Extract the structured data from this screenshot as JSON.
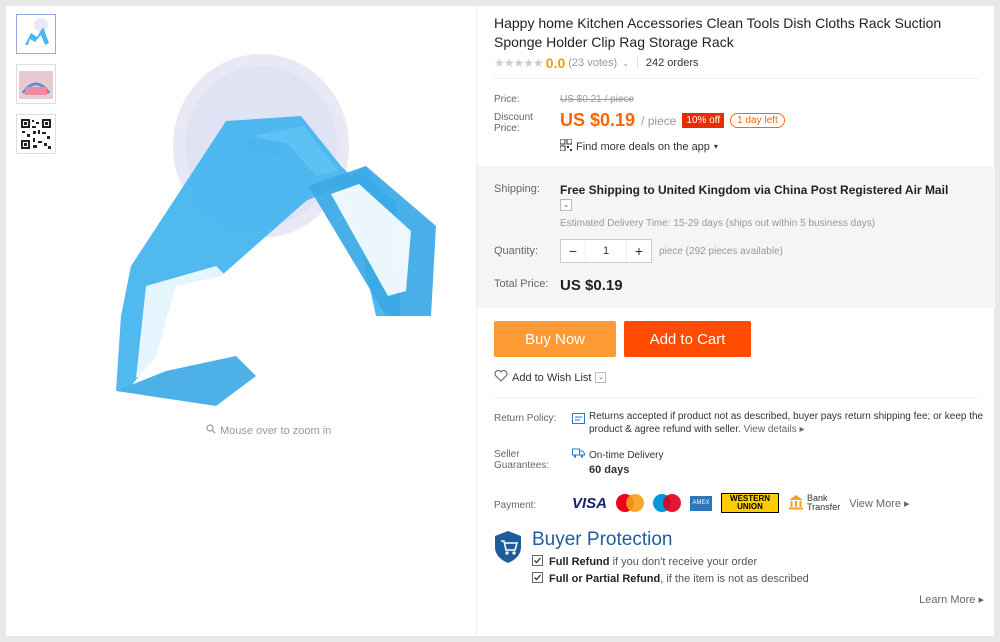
{
  "gallery": {
    "thumbnails": [
      "product-photo",
      "product-in-use-photo",
      "qr-code"
    ],
    "zoom_hint": "Mouse over to zoom in"
  },
  "product": {
    "title": "Happy home Kitchen Accessories Clean Tools Dish Cloths Rack Suction Sponge Holder Clip Rag Storage Rack",
    "rating_value": "0.0",
    "votes": "(23 votes)",
    "orders": "242 orders"
  },
  "pricing": {
    "price_label": "Price:",
    "old_price": "US $0.21 / piece",
    "discount_label": "Discount Price:",
    "discount_price": "US $0.19",
    "unit": "/ piece",
    "discount_badge": "10% off",
    "time_badge": "1 day left",
    "app_deals": "Find more deals on the app"
  },
  "shipping": {
    "label": "Shipping:",
    "free_text": "Free Shipping to",
    "destination": "United Kingdom via China Post Registered Air Mail",
    "estimate": "Estimated Delivery Time: 15-29 days (ships out within 5 business days)"
  },
  "quantity": {
    "label": "Quantity:",
    "value": "1",
    "minus": "−",
    "plus": "+",
    "available": "piece (292 pieces available)"
  },
  "total": {
    "label": "Total Price:",
    "value": "US $0.19"
  },
  "actions": {
    "buy_now": "Buy Now",
    "add_to_cart": "Add to Cart",
    "wish_list": "Add to Wish List"
  },
  "policy": {
    "return_label": "Return Policy:",
    "return_text": "Returns accepted if product not as described, buyer pays return shipping fee; or keep the product & agree refund with seller.",
    "view_details": "View details ▸",
    "guarantee_label_1": "Seller",
    "guarantee_label_2": "Guarantees:",
    "on_time": "On-time Delivery",
    "days": "60 days",
    "payment_label": "Payment:",
    "visa": "VISA",
    "amex": "AMEX",
    "wu": "WESTERN UNION",
    "bank_line1": "Bank",
    "bank_line2": "Transfer",
    "view_more": "View More ▸"
  },
  "protection": {
    "title": "Buyer Protection",
    "line1_bold": "Full Refund",
    "line1_rest": "if you don't receive your order",
    "line2_bold": "Full or Partial Refund",
    "line2_rest": ", if the item is not as described",
    "learn_more": "Learn More ▸"
  },
  "colors": {
    "accent_orange": "#ff9933",
    "cart_orange": "#ff4c00",
    "price_orange": "#ff6600",
    "protection_blue": "#1f5c9c",
    "product_blue": "#3aa8e6"
  }
}
